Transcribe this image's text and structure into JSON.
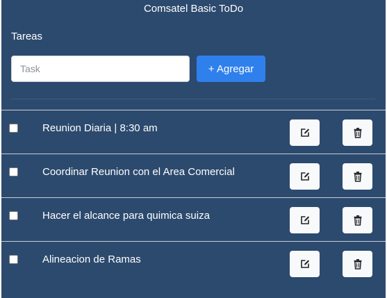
{
  "app": {
    "title": "Comsatel Basic ToDo"
  },
  "form": {
    "section_label": "Tareas",
    "input_placeholder": "Task",
    "input_value": "",
    "add_button_label": "+ Agregar"
  },
  "tasks": [
    {
      "text": "Reunion Diaria | 8:30 am",
      "checked": false
    },
    {
      "text": "Coordinar Reunion con el Area Comercial",
      "checked": false
    },
    {
      "text": "Hacer el alcance para quimica suiza",
      "checked": false
    },
    {
      "text": "Alineacion de Ramas",
      "checked": false
    }
  ],
  "icons": {
    "edit": "edit-pencil-icon",
    "delete": "trash-icon"
  },
  "colors": {
    "background": "#2c4a6e",
    "primary_button": "#2f80ed",
    "icon_button": "#f8f9fa",
    "row_divider": "#c6ced8"
  }
}
